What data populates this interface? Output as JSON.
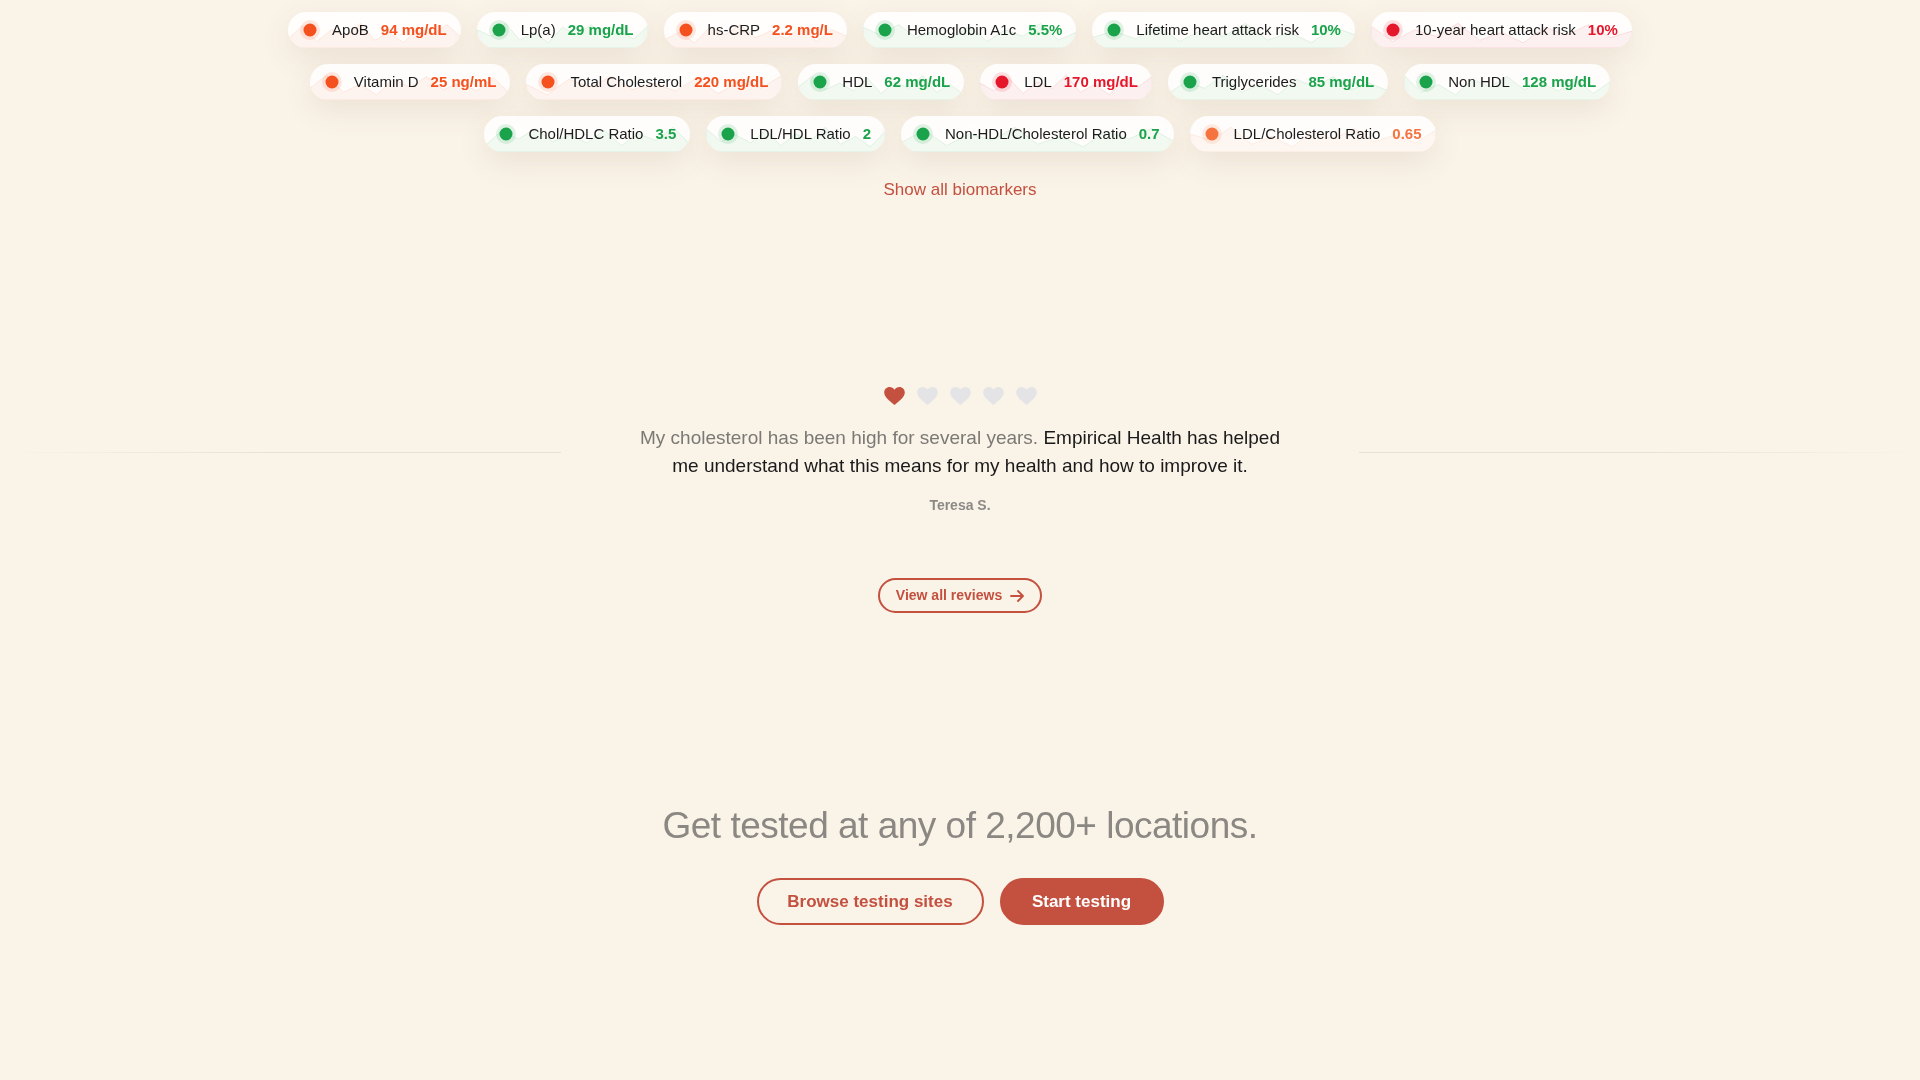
{
  "biomarker_rows": [
    [
      {
        "name": "ApoB",
        "value": "94 mg/dL",
        "color": "#f4511e"
      },
      {
        "name": "Lp(a)",
        "value": "29 mg/dL",
        "color": "#1aa34a"
      },
      {
        "name": "hs-CRP",
        "value": "2.2 mg/L",
        "color": "#f4511e"
      },
      {
        "name": "Hemoglobin A1c",
        "value": "5.5%",
        "color": "#1aa34a"
      },
      {
        "name": "Lifetime heart attack risk",
        "value": "10%",
        "color": "#1aa34a"
      },
      {
        "name": "10-year heart attack risk",
        "value": "10%",
        "color": "#e5172b"
      }
    ],
    [
      {
        "name": "Vitamin D",
        "value": "25 ng/mL",
        "color": "#f4511e"
      },
      {
        "name": "Total Cholesterol",
        "value": "220 mg/dL",
        "color": "#f4511e"
      },
      {
        "name": "HDL",
        "value": "62 mg/dL",
        "color": "#1aa34a"
      },
      {
        "name": "LDL",
        "value": "170 mg/dL",
        "color": "#e5172b"
      },
      {
        "name": "Triglycerides",
        "value": "85 mg/dL",
        "color": "#1aa34a"
      },
      {
        "name": "Non HDL",
        "value": "128 mg/dL",
        "color": "#1aa34a"
      }
    ],
    [
      {
        "name": "Chol/HDLC Ratio",
        "value": "3.5",
        "color": "#1aa34a"
      },
      {
        "name": "LDL/HDL Ratio",
        "value": "2",
        "color": "#1aa34a"
      },
      {
        "name": "Non-HDL/Cholesterol Ratio",
        "value": "0.7",
        "color": "#1aa34a"
      },
      {
        "name": "LDL/Cholesterol Ratio",
        "value": "0.65",
        "color": "#f4733f"
      }
    ]
  ],
  "show_all_link": "Show all biomarkers",
  "testimonial": {
    "stars": 1,
    "quote_intro": "My cholesterol has been high for several years.",
    "quote": "Empirical Health has helped me understand what this means for my health and how to improve it.",
    "author": "Teresa S."
  },
  "reviews_button": "View all reviews",
  "cta": {
    "heading": "Get tested at any of 2,200+ locations.",
    "buttons": [
      {
        "label": "Browse testing sites",
        "kind": "outline"
      },
      {
        "label": "Start testing",
        "kind": "filled"
      }
    ]
  }
}
